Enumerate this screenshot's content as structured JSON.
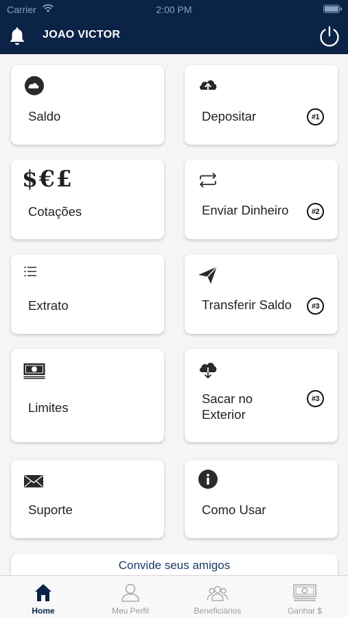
{
  "status_bar": {
    "carrier": "Carrier",
    "time": "2:00 PM"
  },
  "header": {
    "user_name": "JOAO VICTOR",
    "background": "#0b2346"
  },
  "cards": {
    "saldo": {
      "label": "Saldo",
      "icon": "cloud-circle-icon"
    },
    "depositar": {
      "label": "Depositar",
      "icon": "cloud-upload-icon",
      "badge": "#1"
    },
    "cotacoes": {
      "label": "Cotações",
      "symbols": "$€£",
      "icon": "currency-icon"
    },
    "enviar": {
      "label": "Enviar Dinheiro",
      "icon": "repeat-icon",
      "badge": "#2"
    },
    "extrato": {
      "label": "Extrato",
      "icon": "list-icon"
    },
    "transferir": {
      "label": "Transferir Saldo",
      "icon": "paper-plane-icon",
      "badge": "#3"
    },
    "limites": {
      "label": "Limites",
      "icon": "banknote-icon"
    },
    "sacar": {
      "label_line1": "Sacar no",
      "label_line2": "Exterior",
      "icon": "cloud-download-icon",
      "badge": "#3"
    },
    "suporte": {
      "label": "Suporte",
      "icon": "envelope-icon"
    },
    "como_usar": {
      "label": "Como Usar",
      "icon": "info-icon"
    }
  },
  "invite": {
    "label": "Convide seus amigos"
  },
  "tabs": [
    {
      "label": "Home",
      "icon": "home-icon",
      "active": true
    },
    {
      "label": "Meu Perfil",
      "icon": "profile-icon",
      "active": false
    },
    {
      "label": "Beneficiários",
      "icon": "people-icon",
      "active": false
    },
    {
      "label": "Ganhar $",
      "icon": "money-icon",
      "active": false
    }
  ]
}
